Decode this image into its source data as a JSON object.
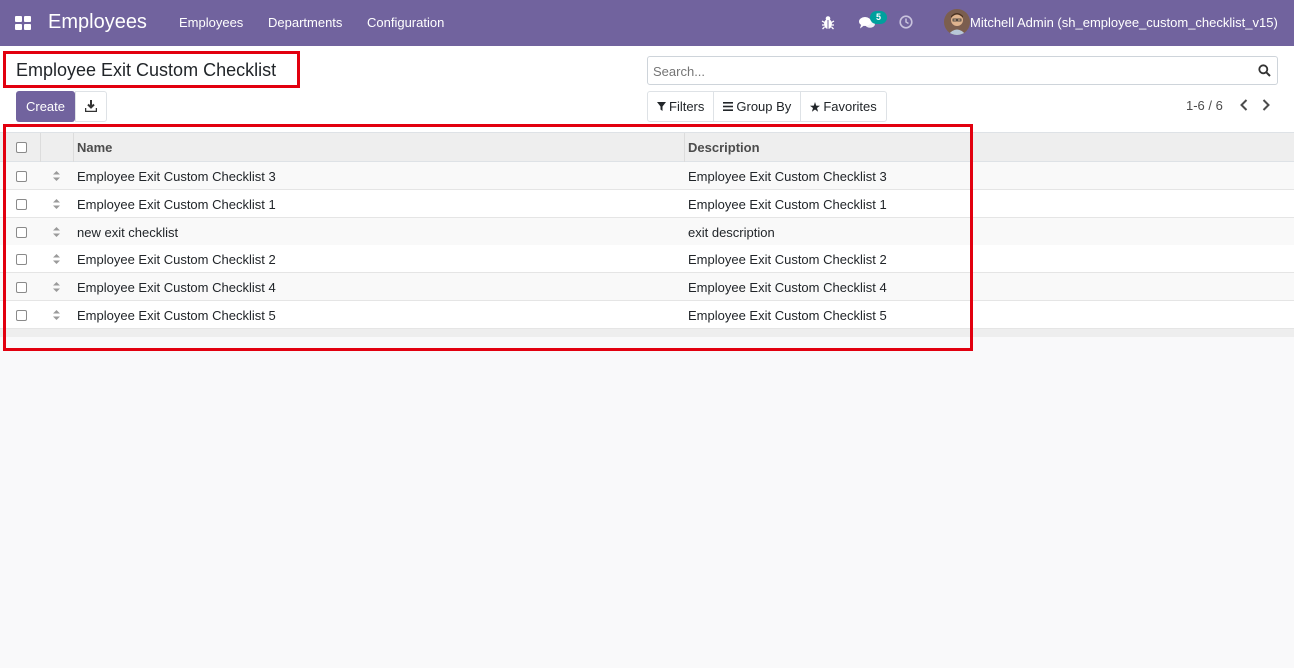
{
  "navbar": {
    "brand": "Employees",
    "menu": [
      "Employees",
      "Departments",
      "Configuration"
    ],
    "icons": [
      "apps-grid-icon",
      "bug-icon",
      "chat-icon",
      "clock-icon"
    ],
    "messages_badge": "5",
    "user": "Mitchell Admin (sh_employee_custom_checklist_v15)",
    "color": "#71639e"
  },
  "control": {
    "title": "Employee Exit Custom Checklist",
    "create_label": "Create",
    "search_placeholder": "Search...",
    "filters_label": "Filters",
    "group_by_label": "Group By",
    "favorites_label": "Favorites",
    "pager": "1-6 / 6"
  },
  "table": {
    "headers": {
      "name": "Name",
      "description": "Description"
    },
    "rows": [
      {
        "name": "Employee Exit Custom Checklist 3",
        "description": "Employee Exit Custom Checklist 3"
      },
      {
        "name": "Employee Exit Custom Checklist 1",
        "description": "Employee Exit Custom Checklist 1"
      },
      {
        "name": "new exit checklist",
        "description": "exit description"
      },
      {
        "name": "Employee Exit Custom Checklist 2",
        "description": "Employee Exit Custom Checklist 2"
      },
      {
        "name": "Employee Exit Custom Checklist 4",
        "description": "Employee Exit Custom Checklist 4"
      },
      {
        "name": "Employee Exit Custom Checklist 5",
        "description": "Employee Exit Custom Checklist 5"
      }
    ]
  },
  "highlight_color": "#e2000f"
}
